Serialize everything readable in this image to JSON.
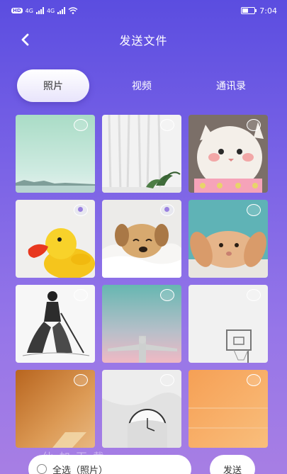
{
  "status_bar": {
    "time": "7:04",
    "hd": "HD",
    "network_1": "4G",
    "network_2": "4G",
    "battery_level": 0.5
  },
  "header": {
    "title": "发送文件",
    "back_icon": "chevron-left-icon"
  },
  "tabs": [
    {
      "label": "照片",
      "active": true
    },
    {
      "label": "视频",
      "active": false
    },
    {
      "label": "通讯录",
      "active": false
    }
  ],
  "photos": [
    {
      "subject": "teal sky with distant pier",
      "selected": false
    },
    {
      "subject": "white sheer curtain with plant",
      "selected": false
    },
    {
      "subject": "white persian cat with pink blush",
      "selected": false
    },
    {
      "subject": "yellow rubber duck",
      "selected": true
    },
    {
      "subject": "puppy in white blanket",
      "selected": true
    },
    {
      "subject": "rabbit with floppy ears",
      "selected": false
    },
    {
      "subject": "sketch of samurai warrior",
      "selected": false
    },
    {
      "subject": "christ the redeemer statue at dusk",
      "selected": false
    },
    {
      "subject": "basketball hoop on white wall",
      "selected": false
    },
    {
      "subject": "orange wall with window light",
      "selected": false
    },
    {
      "subject": "white clock in pocket",
      "selected": false
    },
    {
      "subject": "orange gradient with lines",
      "selected": false
    }
  ],
  "bottom": {
    "select_all_label": "全选（照片）",
    "send_label": "发送"
  },
  "watermark": "仙 加 下 载"
}
